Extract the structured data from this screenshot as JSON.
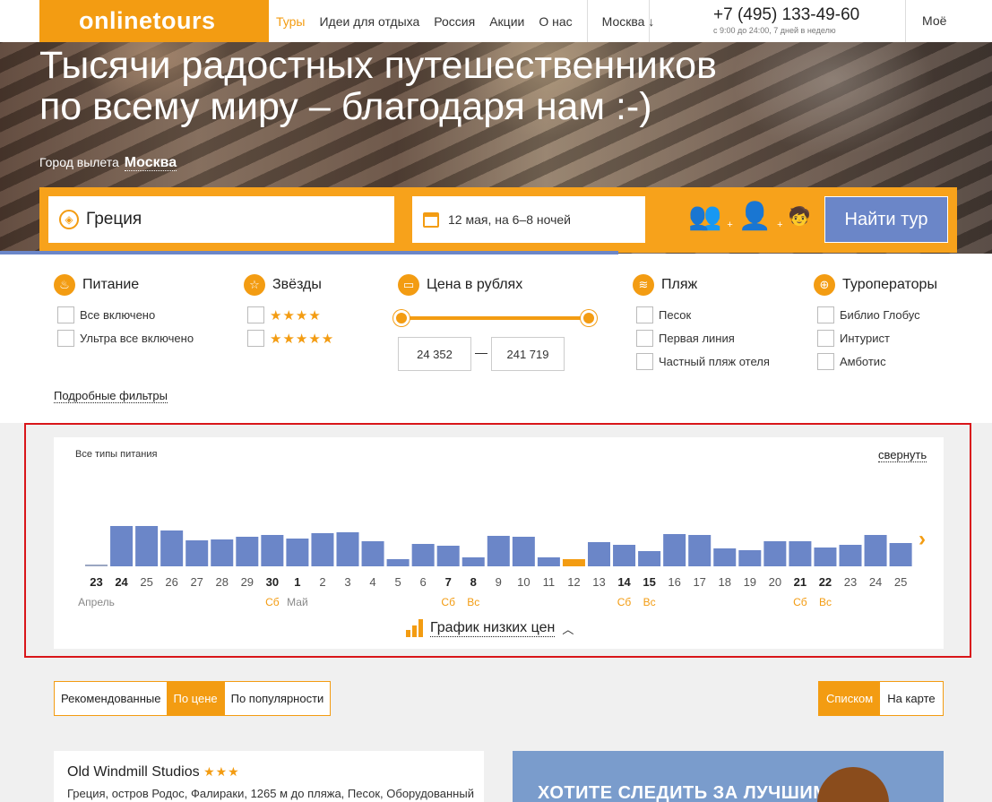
{
  "header": {
    "logo": "onlinetours",
    "nav": [
      {
        "label": "Туры",
        "active": true
      },
      {
        "label": "Идеи для отдыха",
        "active": false
      },
      {
        "label": "Россия",
        "active": false
      },
      {
        "label": "Акции",
        "active": false
      },
      {
        "label": "О нас",
        "active": false
      }
    ],
    "city": "Москва ↓",
    "phone": "+7 (495) 133-49-60",
    "hours": "с 9:00 до 24:00, 7 дней в неделю",
    "account": "Моё"
  },
  "hero": {
    "headline_line1": "Тысячи радостных путешественников",
    "headline_line2": "по всему миру – благодаря нам :-)",
    "depart_label": "Город вылета",
    "depart_city": "Москва"
  },
  "search": {
    "destination": "Греция",
    "dates": "12 мая, на 6–8 ночей",
    "button": "Найти тур"
  },
  "filters": {
    "food": {
      "title": "Питание",
      "options": [
        "Все включено",
        "Ультра все включено"
      ]
    },
    "stars": {
      "title": "Звёзды",
      "options": [
        "★★★★",
        "★★★★★"
      ]
    },
    "price": {
      "title": "Цена в рублях",
      "min": "24 352",
      "max": "241 719"
    },
    "beach": {
      "title": "Пляж",
      "options": [
        "Песок",
        "Первая линия",
        "Частный пляж отеля"
      ]
    },
    "operators": {
      "title": "Туроператоры",
      "options": [
        "Библио Глобус",
        "Интурист",
        "Амботис"
      ]
    },
    "more": "Подробные фильтры"
  },
  "chart": {
    "title": "Все типы питания",
    "collapse": "свернуть",
    "footer": "График низких цен",
    "highlight_color": "#f39c12",
    "bar_color": "#6b86c8"
  },
  "chart_data": {
    "type": "bar",
    "categories": [
      "23",
      "24",
      "25",
      "26",
      "27",
      "28",
      "29",
      "30",
      "1",
      "2",
      "3",
      "4",
      "5",
      "6",
      "7",
      "8",
      "9",
      "10",
      "11",
      "12",
      "13",
      "14",
      "15",
      "16",
      "17",
      "18",
      "19",
      "20",
      "21",
      "22",
      "23",
      "24",
      "25"
    ],
    "values": [
      2,
      45,
      45,
      40,
      29,
      30,
      33,
      35,
      31,
      37,
      38,
      28,
      8,
      25,
      23,
      10,
      34,
      33,
      10,
      8,
      27,
      24,
      17,
      36,
      35,
      20,
      18,
      28,
      28,
      21,
      24,
      35,
      26
    ],
    "bold": [
      true,
      true,
      false,
      false,
      false,
      false,
      false,
      true,
      true,
      false,
      false,
      false,
      false,
      false,
      true,
      true,
      false,
      false,
      false,
      false,
      false,
      true,
      true,
      false,
      false,
      false,
      false,
      false,
      true,
      true,
      false,
      false,
      false
    ],
    "highlight_index": 19,
    "sublabels": [
      "Апрель",
      "",
      "",
      "",
      "",
      "",
      "",
      "Сб",
      "Май",
      "",
      "",
      "",
      "",
      "",
      "Сб",
      "Вс",
      "",
      "",
      "",
      "",
      "",
      "Сб",
      "Вс",
      "",
      "",
      "",
      "",
      "",
      "Сб",
      "Вс",
      "",
      "",
      ""
    ],
    "ylim": [
      0,
      50
    ]
  },
  "sort": {
    "options": [
      "Рекомендованные",
      "По цене",
      "По популярности"
    ],
    "active": 1
  },
  "view": {
    "options": [
      "Списком",
      "На карте"
    ],
    "active": 0
  },
  "hotel": {
    "name": "Old Windmill Studios",
    "stars": "★★★",
    "desc": "Греция, остров Родос, Фалираки, 1265 м до пляжа, Песок, Оборудованный"
  },
  "promo": {
    "text": "ХОТИТЕ СЛЕДИТЬ ЗА ЛУЧШИМИ"
  }
}
